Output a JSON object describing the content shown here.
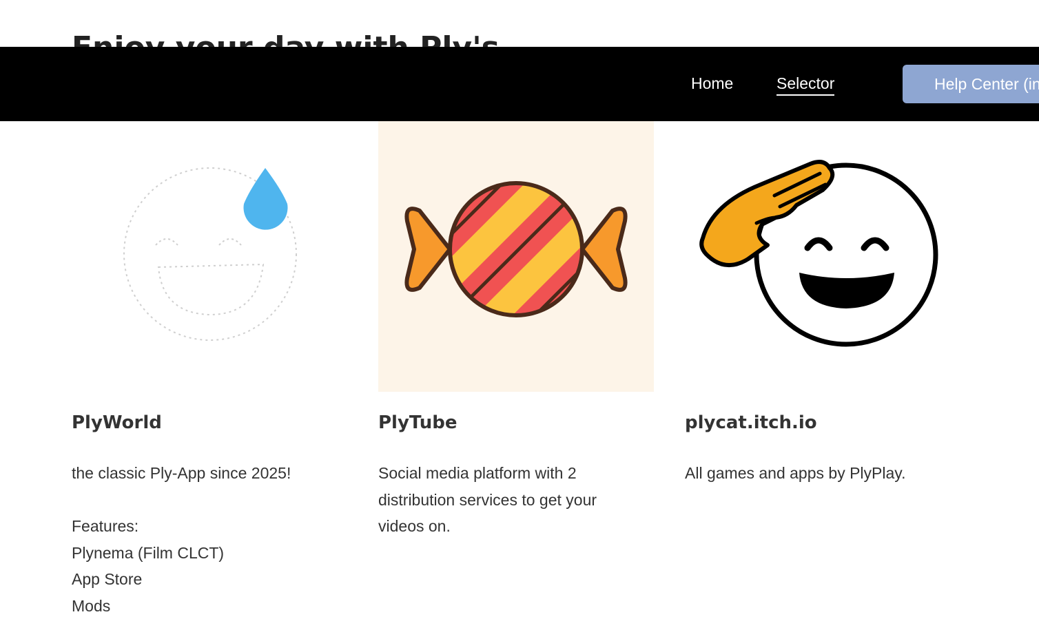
{
  "hero": {
    "title": "Enjoy your day with Ply's"
  },
  "nav": {
    "items": [
      {
        "label": "Home",
        "active": false
      },
      {
        "label": "Selector",
        "active": true
      }
    ],
    "help_button": "Help Center (in"
  },
  "cards": [
    {
      "title": "PlyWorld",
      "description": "the classic Ply-App since 2025!",
      "features_heading": "Features:",
      "features": [
        "Plynema (Film CLCT)",
        "App Store",
        "Mods"
      ],
      "icon": "sweat-smile-face-icon"
    },
    {
      "title": "PlyTube",
      "description": "Social media platform with 2 distribution services to get your videos on.",
      "icon": "candy-icon"
    },
    {
      "title": "plycat.itch.io",
      "description": "All games and apps by PlyPlay.",
      "icon": "saluting-face-icon"
    }
  ],
  "colors": {
    "navbar": "#000000",
    "help_button": "#8ea6d2",
    "candy_card_bg": "#fdf4e8",
    "text": "#333333"
  }
}
